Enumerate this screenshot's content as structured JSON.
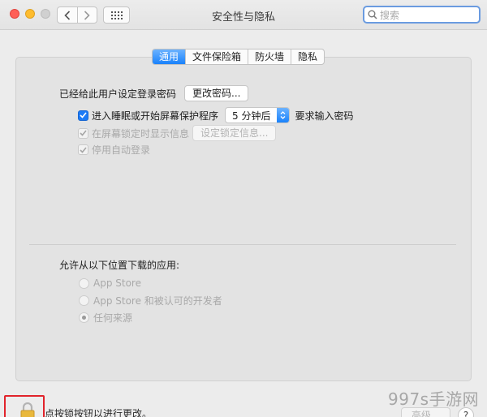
{
  "window": {
    "title": "安全性与隐私"
  },
  "search": {
    "placeholder": "搜索"
  },
  "tabs": [
    {
      "label": "通用",
      "active": true
    },
    {
      "label": "文件保险箱",
      "active": false
    },
    {
      "label": "防火墙",
      "active": false
    },
    {
      "label": "隐私",
      "active": false
    }
  ],
  "general": {
    "password_set_text": "已经给此用户设定登录密码",
    "change_password_button": "更改密码...",
    "require_password": {
      "checked": true,
      "label": "进入睡眠或开始屏幕保护程序",
      "delay_value": "5 分钟后",
      "suffix": "要求输入密码"
    },
    "show_message": {
      "checked": true,
      "enabled": false,
      "label": "在屏幕锁定时显示信息",
      "button": "设定锁定信息..."
    },
    "disable_autologin": {
      "checked": true,
      "enabled": false,
      "label": "停用自动登录"
    }
  },
  "downloads": {
    "heading": "允许从以下位置下载的应用:",
    "options": [
      {
        "label": "App Store",
        "selected": false
      },
      {
        "label": "App Store 和被认可的开发者",
        "selected": false
      },
      {
        "label": "任何来源",
        "selected": true
      }
    ]
  },
  "footer": {
    "lock_text": "点按锁按钮以进行更改。",
    "advanced_button": "高级...",
    "help_button": "?"
  },
  "watermark": "997s手游网",
  "colors": {
    "accent": "#1d7bf6",
    "lock_highlight": "#e1232b"
  }
}
